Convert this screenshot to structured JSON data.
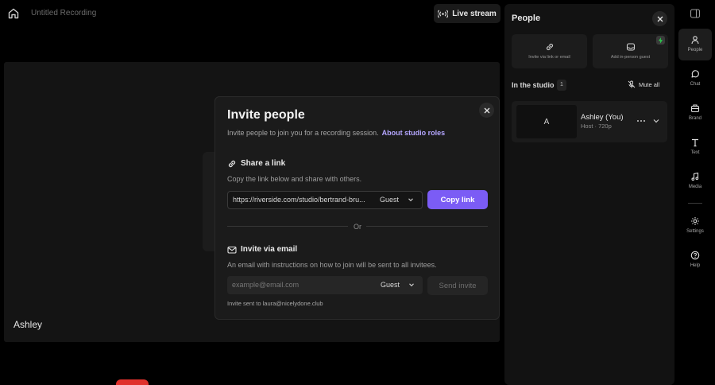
{
  "topbar": {
    "home_icon": "home-icon",
    "recording_title": "Untitled Recording",
    "live_stream_label": "Live stream",
    "live_stream_icon": "broadcast-icon"
  },
  "stage": {
    "participant_label": "Ashley"
  },
  "people_panel": {
    "title": "People",
    "cards": [
      {
        "label": "Invite via link or email",
        "icon": "link-icon"
      },
      {
        "label": "Add in-person guest",
        "icon": "inbox-icon"
      }
    ],
    "in_studio_label": "In the studio",
    "in_studio_count": "1",
    "mute_all_label": "Mute all",
    "person": {
      "avatar_initial": "A",
      "name": "Ashley (You)",
      "role_resolution": "Host · 720p"
    }
  },
  "right_nav": {
    "items": [
      {
        "label": "People",
        "icon": "people-icon"
      },
      {
        "label": "Chat",
        "icon": "chat-icon"
      },
      {
        "label": "Brand",
        "icon": "brand-icon"
      },
      {
        "label": "Text",
        "icon": "text-icon"
      },
      {
        "label": "Media",
        "icon": "music-note-icon"
      },
      {
        "label": "Settings",
        "icon": "gear-icon"
      },
      {
        "label": "Help",
        "icon": "help-icon"
      }
    ]
  },
  "modal": {
    "title": "Invite people",
    "subtitle": "Invite people to join you for a recording session.",
    "roles_link": "About studio roles",
    "share": {
      "title": "Share a link",
      "description": "Copy the link below and share with others.",
      "link_value": "https://riverside.com/studio/bertrand-bru...",
      "role": "Guest",
      "copy_button": "Copy link"
    },
    "or_text": "Or",
    "email": {
      "title": "Invite via email",
      "description": "An email with instructions on how to join will be sent to all invitees.",
      "placeholder": "example@email.com",
      "role": "Guest",
      "send_button": "Send invite",
      "sent_notice": "Invite sent to laura@nicelydone.club"
    }
  },
  "colors": {
    "accent": "#7b5cf5",
    "link": "#b4a6ff",
    "record": "#e0312c"
  }
}
